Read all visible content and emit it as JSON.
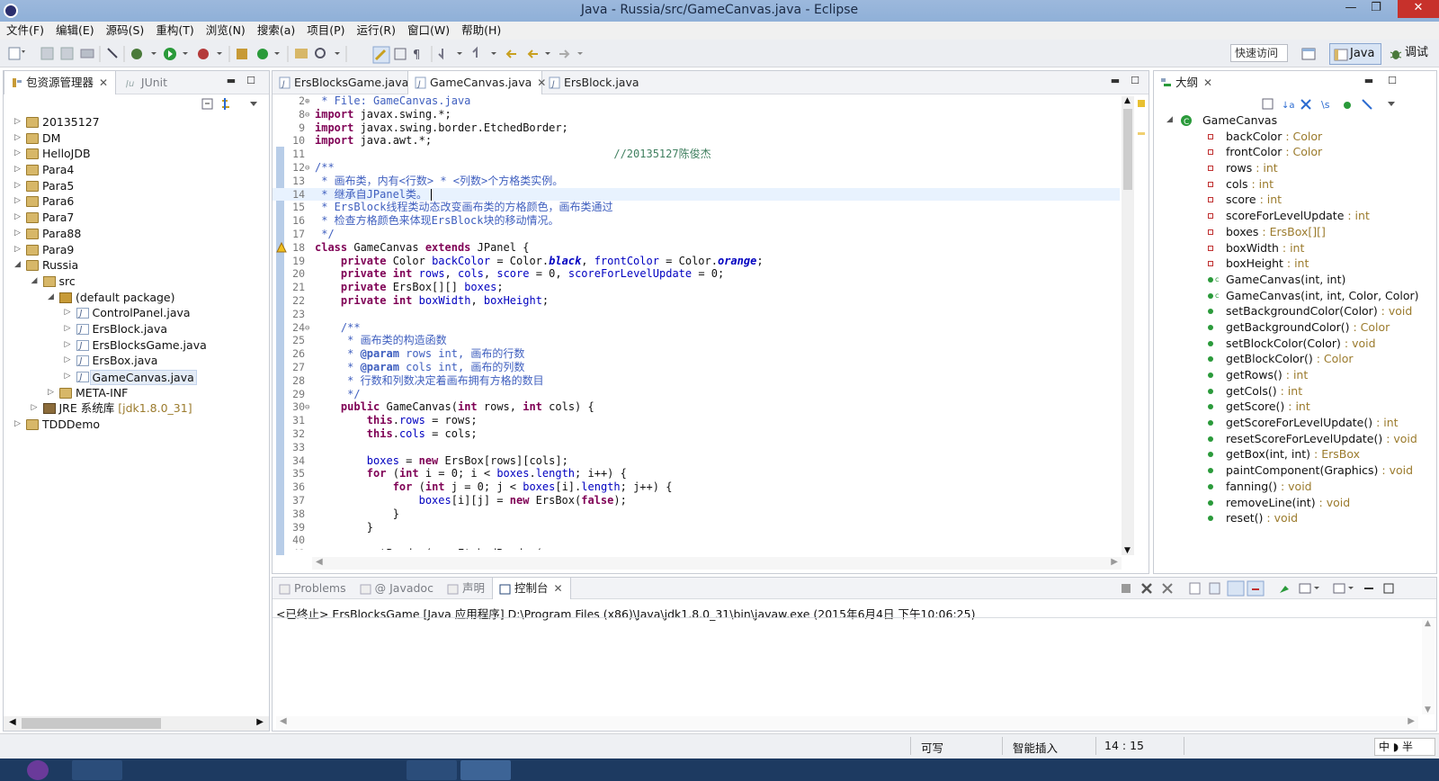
{
  "window": {
    "title": "Java - Russia/src/GameCanvas.java - Eclipse",
    "minimize": "—",
    "maximize": "❐",
    "close": "✕"
  },
  "menu": [
    "文件(F)",
    "编辑(E)",
    "源码(S)",
    "重构(T)",
    "浏览(N)",
    "搜索(a)",
    "项目(P)",
    "运行(R)",
    "窗口(W)",
    "帮助(H)"
  ],
  "toolbar": {
    "quick_access": "快速访问",
    "perspectives": [
      {
        "label": "Java",
        "active": true
      },
      {
        "label": "调试",
        "active": false
      }
    ]
  },
  "package_explorer": {
    "tabs": [
      {
        "label": "包资源管理器",
        "active": true
      },
      {
        "label": "JUnit",
        "active": false
      }
    ],
    "tree": [
      {
        "label": "20135127",
        "depth": 0,
        "expanded": false,
        "icon": "project-icon"
      },
      {
        "label": "DM",
        "depth": 0,
        "expanded": false,
        "icon": "project-icon"
      },
      {
        "label": "HelloJDB",
        "depth": 0,
        "expanded": false,
        "icon": "project-icon"
      },
      {
        "label": "Para4",
        "depth": 0,
        "expanded": false,
        "icon": "project-icon"
      },
      {
        "label": "Para5",
        "depth": 0,
        "expanded": false,
        "icon": "project-icon"
      },
      {
        "label": "Para6",
        "depth": 0,
        "expanded": false,
        "icon": "project-icon"
      },
      {
        "label": "Para7",
        "depth": 0,
        "expanded": false,
        "icon": "project-icon"
      },
      {
        "label": "Para88",
        "depth": 0,
        "expanded": false,
        "icon": "project-icon"
      },
      {
        "label": "Para9",
        "depth": 0,
        "expanded": false,
        "icon": "project-icon"
      },
      {
        "label": "Russia",
        "depth": 0,
        "expanded": true,
        "icon": "project-icon"
      },
      {
        "label": "src",
        "depth": 1,
        "expanded": true,
        "icon": "source-folder-icon"
      },
      {
        "label": "(default package)",
        "depth": 2,
        "expanded": true,
        "icon": "package-icon"
      },
      {
        "label": "ControlPanel.java",
        "depth": 3,
        "expanded": false,
        "icon": "java-file-icon"
      },
      {
        "label": "ErsBlock.java",
        "depth": 3,
        "expanded": false,
        "icon": "java-file-icon"
      },
      {
        "label": "ErsBlocksGame.java",
        "depth": 3,
        "expanded": false,
        "icon": "java-file-icon"
      },
      {
        "label": "ErsBox.java",
        "depth": 3,
        "expanded": false,
        "icon": "java-file-icon"
      },
      {
        "label": "GameCanvas.java",
        "depth": 3,
        "expanded": false,
        "icon": "java-file-icon",
        "selected": true
      },
      {
        "label": "META-INF",
        "depth": 2,
        "expanded": false,
        "icon": "folder-icon"
      },
      {
        "label": "JRE 系统库",
        "extra": " [jdk1.8.0_31]",
        "depth": 1,
        "expanded": false,
        "icon": "library-icon"
      },
      {
        "label": "TDDDemo",
        "depth": 0,
        "expanded": false,
        "icon": "project-icon"
      }
    ]
  },
  "editor": {
    "tabs": [
      {
        "label": "ErsBlocksGame.java",
        "active": false
      },
      {
        "label": "GameCanvas.java",
        "active": true
      },
      {
        "label": "ErsBlock.java",
        "active": false
      }
    ],
    "lines": [
      {
        "n": "2",
        "f": "⊕",
        "h": "<span class='cm'> * File: GameCanvas.java</span>"
      },
      {
        "n": "8",
        "f": "⊖",
        "h": "<span class='kw'>import</span> javax.swing.*;"
      },
      {
        "n": "9",
        "f": "",
        "h": "<span class='kw'>import</span> javax.swing.border.EtchedBorder;"
      },
      {
        "n": "10",
        "f": "",
        "h": "<span class='kw'>import</span> java.awt.*;"
      },
      {
        "n": "11",
        "f": "",
        "h": "                                              <span class='lc'>//20135127陈俊杰</span>"
      },
      {
        "n": "12",
        "f": "⊖",
        "h": "<span class='cm'>/**</span>"
      },
      {
        "n": "13",
        "f": "",
        "h": "<span class='cm'> * 画布类，内有&lt;行数&gt; * &lt;列数&gt;个方格类实例。</span>"
      },
      {
        "n": "14",
        "f": "",
        "h": "<span class='cm'> * 继承自JPanel类。</span>",
        "cur": true
      },
      {
        "n": "15",
        "f": "",
        "h": "<span class='cm'> * ErsBlock线程类动态改变画布类的方格颜色，画布类通过</span>"
      },
      {
        "n": "16",
        "f": "",
        "h": "<span class='cm'> * 检查方格颜色来体现ErsBlock块的移动情况。</span>"
      },
      {
        "n": "17",
        "f": "",
        "h": "<span class='cm'> */</span>"
      },
      {
        "n": "18",
        "f": "",
        "h": "<span class='kw'>class</span> GameCanvas <span class='kw'>extends</span> JPanel {"
      },
      {
        "n": "19",
        "f": "",
        "h": "    <span class='kw'>private</span> Color <span class='fd'>backColor</span> = Color.<span class='st'>black</span>, <span class='fd'>frontColor</span> = Color.<span class='st'>orange</span>;"
      },
      {
        "n": "20",
        "f": "",
        "h": "    <span class='kw'>private</span> <span class='kw'>int</span> <span class='fd'>rows</span>, <span class='fd'>cols</span>, <span class='fd'>score</span> = 0, <span class='fd'>scoreForLevelUpdate</span> = 0;"
      },
      {
        "n": "21",
        "f": "",
        "h": "    <span class='kw'>private</span> ErsBox[][] <span class='fd'>boxes</span>;"
      },
      {
        "n": "22",
        "f": "",
        "h": "    <span class='kw'>private</span> <span class='kw'>int</span> <span class='fd'>boxWidth</span>, <span class='fd'>boxHeight</span>;"
      },
      {
        "n": "23",
        "f": "",
        "h": ""
      },
      {
        "n": "24",
        "f": "⊖",
        "h": "    <span class='cm'>/**</span>"
      },
      {
        "n": "25",
        "f": "",
        "h": "<span class='cm'>     * 画布类的构造函数</span>"
      },
      {
        "n": "26",
        "f": "",
        "h": "<span class='cm'>     * <b>@param</b> rows int, 画布的行数</span>"
      },
      {
        "n": "27",
        "f": "",
        "h": "<span class='cm'>     * <b>@param</b> cols int, 画布的列数</span>"
      },
      {
        "n": "28",
        "f": "",
        "h": "<span class='cm'>     * 行数和列数决定着画布拥有方格的数目</span>"
      },
      {
        "n": "29",
        "f": "",
        "h": "<span class='cm'>     */</span>"
      },
      {
        "n": "30",
        "f": "⊖",
        "h": "    <span class='kw'>public</span> GameCanvas(<span class='kw'>int</span> rows, <span class='kw'>int</span> cols) {"
      },
      {
        "n": "31",
        "f": "",
        "h": "        <span class='kw'>this</span>.<span class='fd'>rows</span> = rows;"
      },
      {
        "n": "32",
        "f": "",
        "h": "        <span class='kw'>this</span>.<span class='fd'>cols</span> = cols;"
      },
      {
        "n": "33",
        "f": "",
        "h": ""
      },
      {
        "n": "34",
        "f": "",
        "h": "        <span class='fd'>boxes</span> = <span class='kw'>new</span> ErsBox[rows][cols];"
      },
      {
        "n": "35",
        "f": "",
        "h": "        <span class='kw'>for</span> (<span class='kw'>int</span> i = 0; i &lt; <span class='fd'>boxes</span>.<span class='fd'>length</span>; i++) {"
      },
      {
        "n": "36",
        "f": "",
        "h": "            <span class='kw'>for</span> (<span class='kw'>int</span> j = 0; j &lt; <span class='fd'>boxes</span>[i].<span class='fd'>length</span>; j++) {"
      },
      {
        "n": "37",
        "f": "",
        "h": "                <span class='fd'>boxes</span>[i][j] = <span class='kw'>new</span> ErsBox(<span class='kw'>false</span>);"
      },
      {
        "n": "38",
        "f": "",
        "h": "            }"
      },
      {
        "n": "39",
        "f": "",
        "h": "        }"
      },
      {
        "n": "40",
        "f": "",
        "h": ""
      },
      {
        "n": "41",
        "f": "",
        "h": "        setBorder(<span class='kw'>new</span> EtchedBorder("
      }
    ]
  },
  "outline": {
    "tab": "大纲",
    "root": "GameCanvas",
    "members": [
      {
        "name": "backColor",
        "type": " : Color",
        "kind": "field"
      },
      {
        "name": "frontColor",
        "type": " : Color",
        "kind": "field"
      },
      {
        "name": "rows",
        "type": " : int",
        "kind": "field"
      },
      {
        "name": "cols",
        "type": " : int",
        "kind": "field"
      },
      {
        "name": "score",
        "type": " : int",
        "kind": "field"
      },
      {
        "name": "scoreForLevelUpdate",
        "type": " : int",
        "kind": "field"
      },
      {
        "name": "boxes",
        "type": " : ErsBox[][]",
        "kind": "field"
      },
      {
        "name": "boxWidth",
        "type": " : int",
        "kind": "field"
      },
      {
        "name": "boxHeight",
        "type": " : int",
        "kind": "field"
      },
      {
        "name": "GameCanvas(int, int)",
        "type": "",
        "kind": "ctor"
      },
      {
        "name": "GameCanvas(int, int, Color, Color)",
        "type": "",
        "kind": "ctor"
      },
      {
        "name": "setBackgroundColor(Color)",
        "type": " : void",
        "kind": "method"
      },
      {
        "name": "getBackgroundColor()",
        "type": " : Color",
        "kind": "method"
      },
      {
        "name": "setBlockColor(Color)",
        "type": " : void",
        "kind": "method"
      },
      {
        "name": "getBlockColor()",
        "type": " : Color",
        "kind": "method"
      },
      {
        "name": "getRows()",
        "type": " : int",
        "kind": "method"
      },
      {
        "name": "getCols()",
        "type": " : int",
        "kind": "method"
      },
      {
        "name": "getScore()",
        "type": " : int",
        "kind": "method"
      },
      {
        "name": "getScoreForLevelUpdate()",
        "type": " : int",
        "kind": "method"
      },
      {
        "name": "resetScoreForLevelUpdate()",
        "type": " : void",
        "kind": "method"
      },
      {
        "name": "getBox(int, int)",
        "type": " : ErsBox",
        "kind": "method"
      },
      {
        "name": "paintComponent(Graphics)",
        "type": " : void",
        "kind": "method"
      },
      {
        "name": "fanning()",
        "type": " : void",
        "kind": "method"
      },
      {
        "name": "removeLine(int)",
        "type": " : void",
        "kind": "method"
      },
      {
        "name": "reset()",
        "type": " : void",
        "kind": "method"
      }
    ]
  },
  "bottom": {
    "tabs": [
      {
        "label": "Problems",
        "active": false
      },
      {
        "label": "@ Javadoc",
        "active": false
      },
      {
        "label": "声明",
        "active": false
      },
      {
        "label": "控制台",
        "active": true
      }
    ],
    "launch_info": "<已终止> ErsBlocksGame [Java 应用程序] D:\\Program Files (x86)\\Java\\jdk1.8.0_31\\bin\\javaw.exe  (2015年6月4日 下午10:06:25)"
  },
  "status": {
    "writable": "可写",
    "insert_mode": "智能插入",
    "position": "14 : 15",
    "ime": "中 ◗ 半"
  },
  "colors": {
    "keyword": "#7f0055",
    "comment": "#3f5fbf",
    "field": "#0000c0",
    "title_bar": "#9cb8dc"
  }
}
